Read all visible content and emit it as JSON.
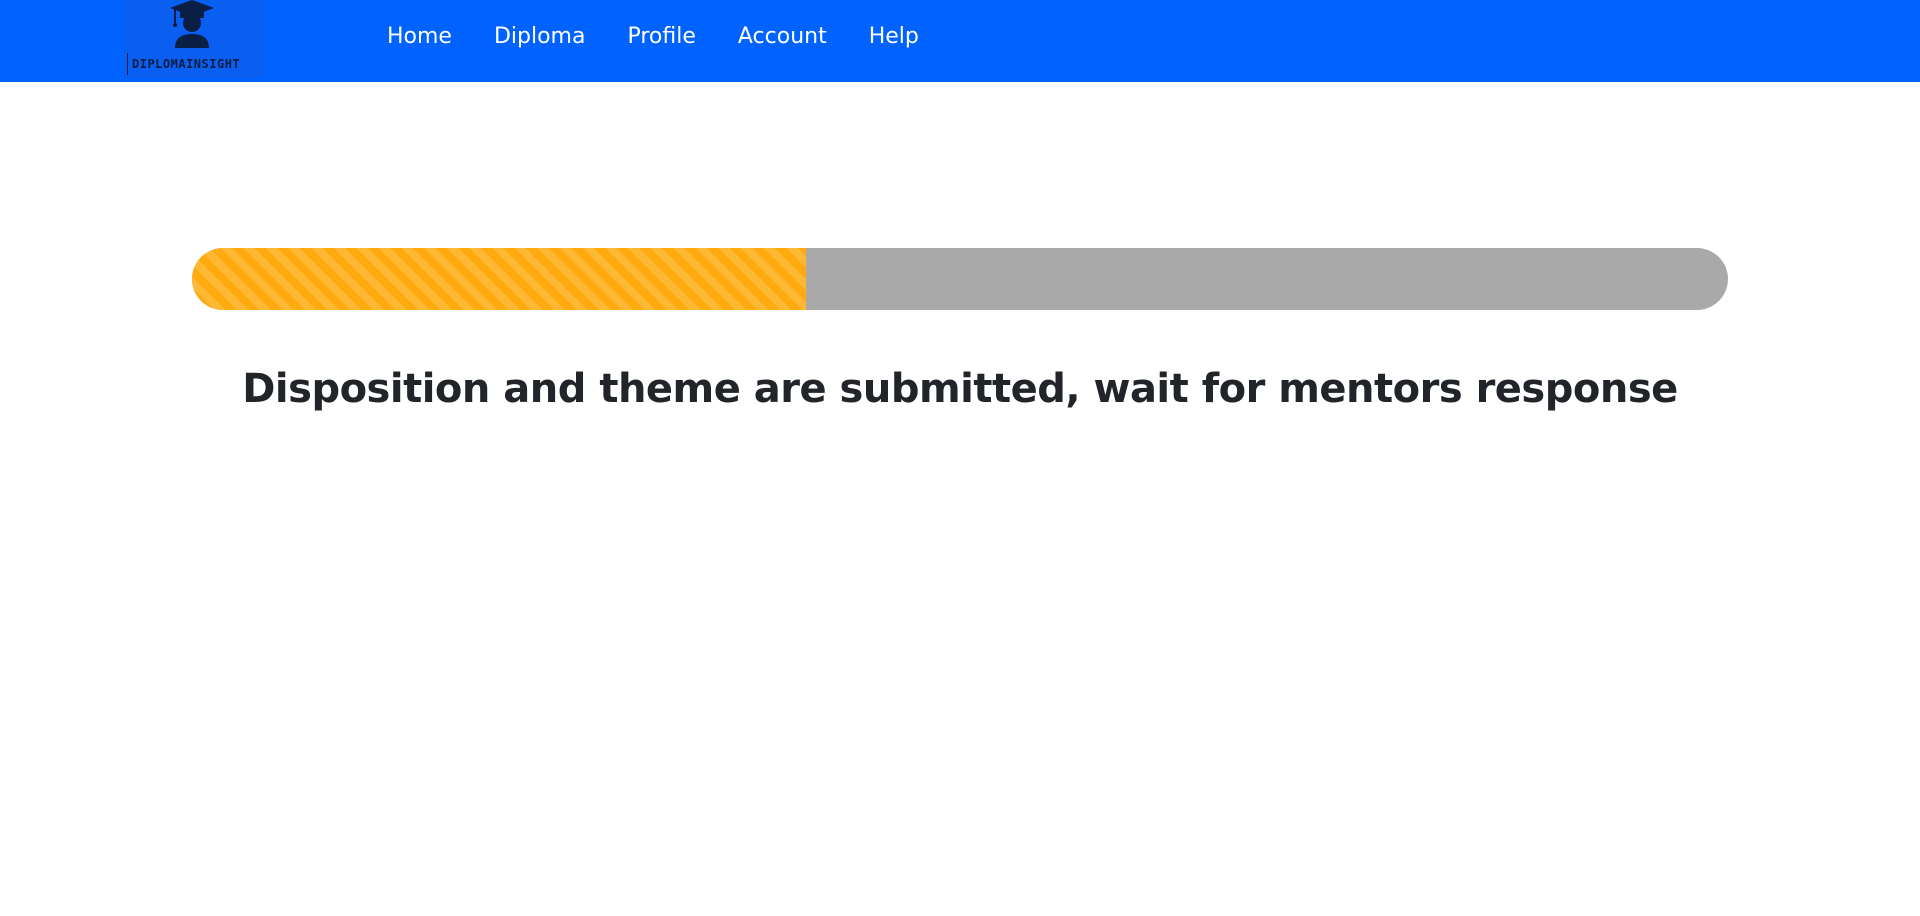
{
  "brand": {
    "name": "DIPLOMAINSIGHT",
    "icon": "graduate-icon"
  },
  "nav": {
    "items": [
      {
        "label": "Home"
      },
      {
        "label": "Diploma"
      },
      {
        "label": "Profile"
      },
      {
        "label": "Account"
      },
      {
        "label": "Help"
      }
    ]
  },
  "progress": {
    "value": 0.4,
    "fill_color": "#ffab0f",
    "track_color": "#a9a9a9"
  },
  "status": {
    "message": "Disposition and theme are submitted, wait for mentors response"
  },
  "colors": {
    "navbar": "#0062ff",
    "text": "#212529"
  }
}
